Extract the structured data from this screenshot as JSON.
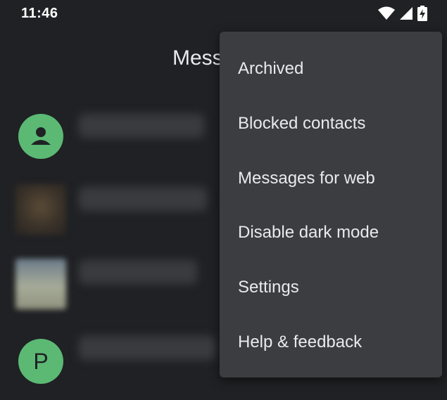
{
  "status_bar": {
    "time": "11:46",
    "icons": [
      "wifi-icon",
      "cell-signal-icon",
      "battery-charging-icon"
    ]
  },
  "app_bar": {
    "title": "Mess"
  },
  "conversations": [
    {
      "avatar": "person-icon",
      "avatar_color": "#5bb974"
    },
    {
      "avatar": "photo",
      "avatar_color": "#4a3f2f"
    },
    {
      "avatar": "photo",
      "avatar_color": "#8a9084"
    },
    {
      "avatar_letter": "P",
      "avatar_color": "#5bb974"
    }
  ],
  "overflow_menu": {
    "items": [
      {
        "label": "Archived"
      },
      {
        "label": "Blocked contacts"
      },
      {
        "label": "Messages for web"
      },
      {
        "label": "Disable dark mode"
      },
      {
        "label": "Settings"
      },
      {
        "label": "Help & feedback"
      }
    ]
  },
  "colors": {
    "background": "#202124",
    "menu_background": "#3c3d41",
    "accent_green": "#5bb974",
    "text": "#e8eaed"
  }
}
